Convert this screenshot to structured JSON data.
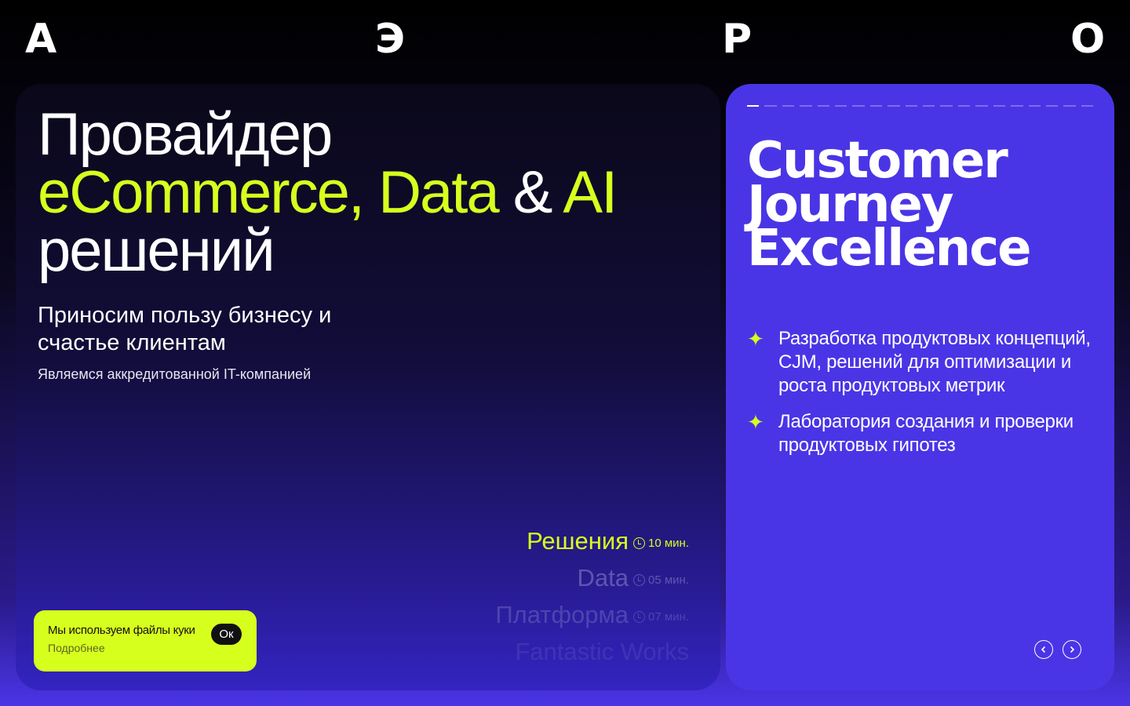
{
  "logo": {
    "letters": [
      "А",
      "Э",
      "Р",
      "О"
    ]
  },
  "hero": {
    "line1": "Провайдер",
    "line2_accent1": "eCommerce, Data",
    "line2_mid": " & ",
    "line2_accent2": "AI",
    "line3": "решений",
    "subtitle": "Приносим пользу бизнесу и счастье клиентам",
    "note": "Являемся аккредитованной IT-компанией"
  },
  "nav": {
    "items": [
      {
        "name": "Решения",
        "time": "10 мин."
      },
      {
        "name": "Data",
        "time": "05 мин."
      },
      {
        "name": "Платформа",
        "time": "07 мин."
      },
      {
        "name": "Fantastic Works",
        "time": ""
      }
    ]
  },
  "cookie": {
    "text": "Мы используем файлы куки",
    "ok_label": "Ок",
    "more_label": "Подробнее"
  },
  "slide": {
    "progress_segments_total": 20,
    "progress_segments_done": 1,
    "title_lines": [
      "Customer",
      "Journey",
      "Excellence"
    ],
    "bullets": [
      "Разработка продуктовых концепций, CJM, решений для оптимизации и роста продуктовых метрик",
      "Лаборатория создания и проверки продуктовых гипотез"
    ]
  },
  "colors": {
    "accent": "#d7ff1e",
    "slide_bg": "#4a35e6"
  },
  "icons": {
    "bullet": "sparkle-icon",
    "prev": "chevron-left-icon",
    "next": "chevron-right-icon",
    "time": "clock-icon"
  }
}
